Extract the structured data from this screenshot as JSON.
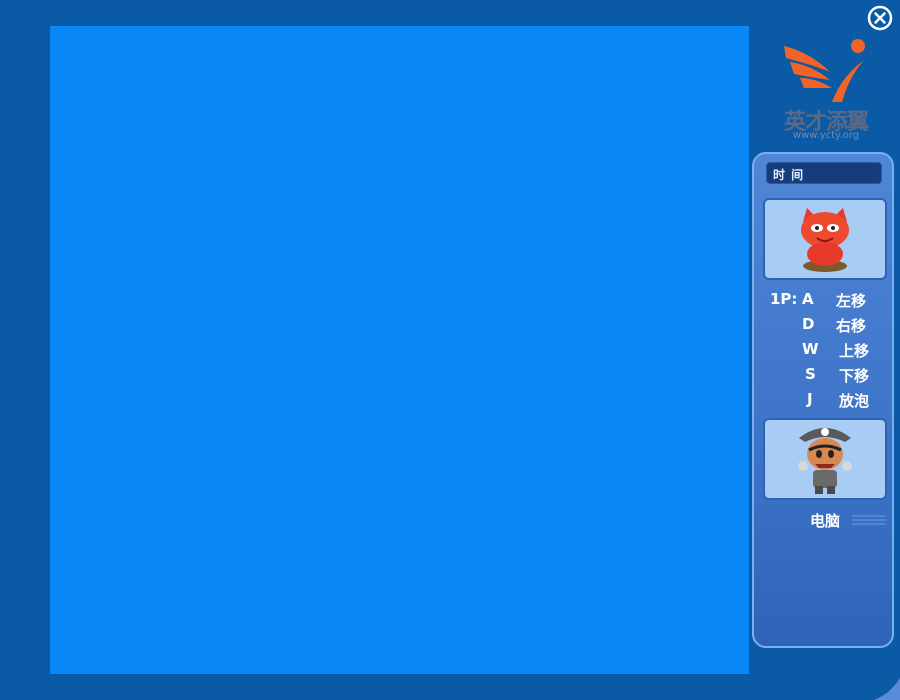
{
  "sidebar": {
    "logo": {
      "text": "英才添翼",
      "url": "www.ycty.org"
    },
    "time_label": "时 间",
    "player1": {
      "prefix": "1P:",
      "controls": [
        {
          "key": "A",
          "action": "左移"
        },
        {
          "key": "D",
          "action": "右移"
        },
        {
          "key": "W",
          "action": "上移"
        },
        {
          "key": "S",
          "action": "下移"
        },
        {
          "key": "J",
          "action": "放泡"
        }
      ]
    },
    "cpu": {
      "label": "电脑"
    }
  },
  "colors": {
    "background": "#0a5aa6",
    "game_area": "#0a88f8",
    "panel": "#3d73c8",
    "logo_orange": "#f0642a"
  },
  "icons": {
    "close": "close-circle-icon",
    "player1_avatar": "red-cat-character-icon",
    "cpu_avatar": "pirate-character-icon"
  }
}
